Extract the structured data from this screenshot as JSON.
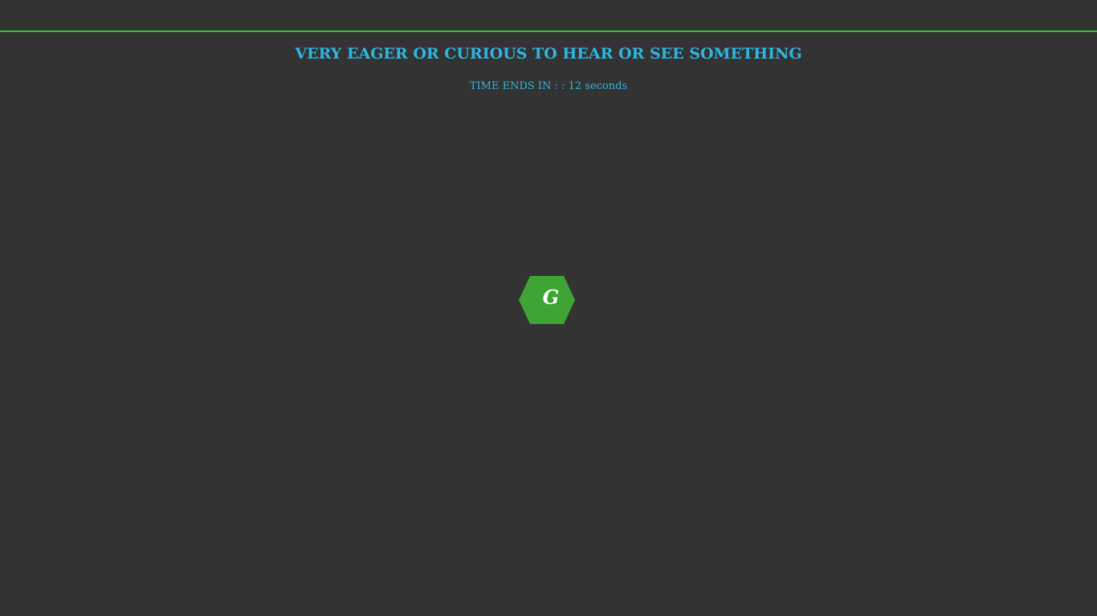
{
  "game": {
    "clue": "VERY EAGER OR CURIOUS TO HEAR OR SEE SOMETHING",
    "timer_label": "TIME ENDS IN : : ",
    "timer_value": "12",
    "timer_unit": " seconds",
    "tiles": [
      {
        "letter": "G"
      }
    ]
  },
  "colors": {
    "background": "#333333",
    "divider": "#2ec42e",
    "text_accent": "#2fb6e0",
    "tile": "#3ea433",
    "tile_letter": "#ffffff"
  }
}
